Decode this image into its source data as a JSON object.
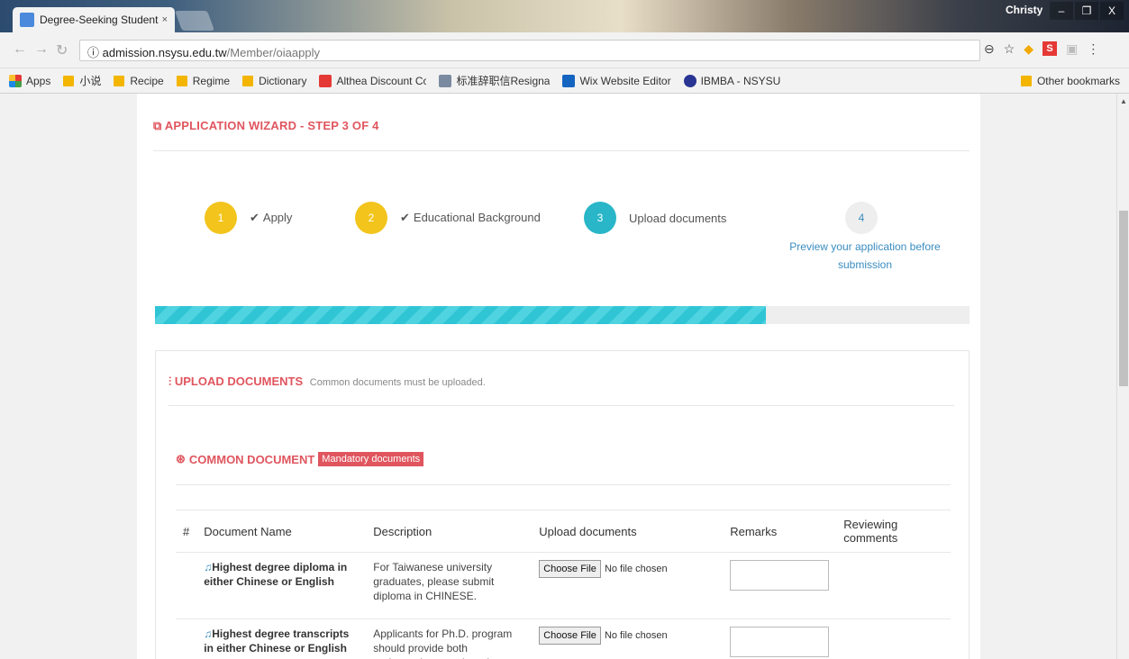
{
  "browser": {
    "tab_title": "Degree-Seeking Student",
    "tab_close": "×",
    "user": "Christy",
    "window_controls": [
      "–",
      "❐",
      "X"
    ],
    "url_host": "admission.nsysu.edu.tw",
    "url_path": "/Member/oiaapply",
    "bookmarks": [
      "Apps",
      "小说",
      "Recipe",
      "Regime",
      "Dictionary",
      "Althea Discount Code",
      "标准辞职信Resignatio",
      "Wix Website Editor",
      "IBMBA - NSYSU"
    ],
    "other_bookmarks": "Other bookmarks"
  },
  "wizard": {
    "title": "APPLICATION WIZARD - STEP 3 OF 4",
    "steps": [
      {
        "num": "1",
        "label": "Apply",
        "done": true
      },
      {
        "num": "2",
        "label": "Educational Background",
        "done": true
      },
      {
        "num": "3",
        "label": "Upload documents",
        "done": false
      },
      {
        "num": "4",
        "label": "Preview your application before submission",
        "done": false
      }
    ],
    "progress_fraction": 0.75
  },
  "upload": {
    "title": "UPLOAD DOCUMENTS",
    "subtitle": "Common documents must be uploaded.",
    "common_title": "COMMON DOCUMENT",
    "common_badge": "Mandatory documents",
    "columns": [
      "#",
      "Document Name",
      "Description",
      "Upload documents",
      "Remarks",
      "Reviewing comments"
    ],
    "choose_label": "Choose File",
    "no_file": "No file chosen",
    "rows": [
      {
        "name": "Highest degree diploma in either Chinese or English",
        "description": "For Taiwanese university graduates, please submit diploma in CHINESE."
      },
      {
        "name": "Highest degree transcripts in either Chinese or English",
        "description": "Applicants for Ph.D. program should provide both undergraduate and graduate"
      }
    ]
  },
  "colors": {
    "accent": "#e0555e",
    "step_done": "#f2c41c",
    "step_active": "#28b6c8",
    "link": "#3a8cc0"
  }
}
